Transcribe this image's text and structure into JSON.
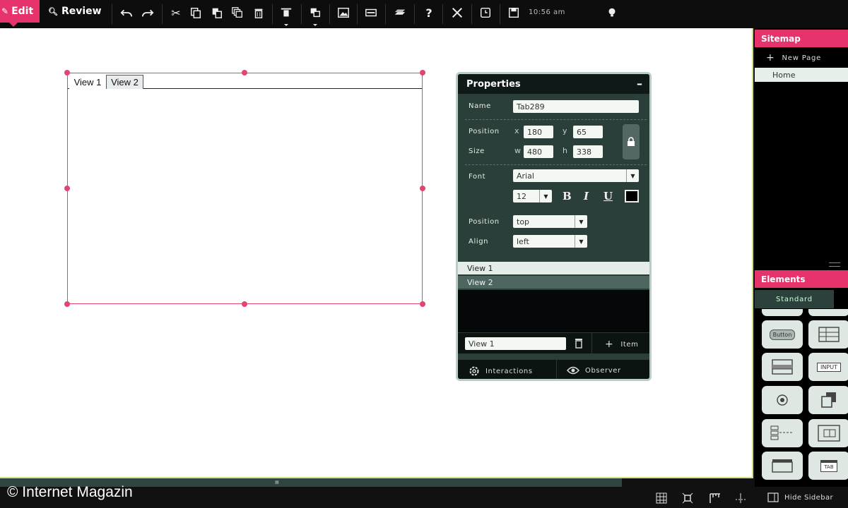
{
  "toolbar": {
    "edit_label": "Edit",
    "review_label": "Review",
    "time": "10:56 am"
  },
  "canvas": {
    "tabs": [
      {
        "label": "View 1",
        "active": true
      },
      {
        "label": "View 2",
        "active": false
      }
    ]
  },
  "watermark": "© Internet Magazin",
  "properties": {
    "title": "Properties",
    "minimize": "–",
    "name_label": "Name",
    "name_value": "Tab289",
    "position_label": "Position",
    "x_label": "x",
    "x_value": "180",
    "y_label": "y",
    "y_value": "65",
    "size_label": "Size",
    "w_label": "w",
    "w_value": "480",
    "h_label": "h",
    "h_value": "338",
    "font_label": "Font",
    "font_value": "Arial",
    "font_size": "12",
    "bold": "B",
    "italic": "I",
    "underline": "U",
    "text_color": "#000000",
    "tab_position_label": "Position",
    "tab_position_value": "top",
    "align_label": "Align",
    "align_value": "left",
    "views": [
      {
        "label": "View 1",
        "selected": true
      },
      {
        "label": "View 2",
        "selected": false
      }
    ],
    "view_name_value": "View 1",
    "add_item_label": "Item",
    "interactions_label": "Interactions",
    "observer_label": "Observer"
  },
  "sidebar": {
    "sitemap_title": "Sitemap",
    "new_page_label": "New Page",
    "pages": [
      "Home"
    ],
    "elements_title": "Elements",
    "elements_tab": "Standard",
    "button_tile_label": "Button",
    "input_tile_label": "INPUT",
    "tab_tile_label": "TAB",
    "hide_label": "Hide Sidebar"
  },
  "colors": {
    "accent": "#e6336b",
    "panel": "#2a3f3a",
    "selection": "#e0466f",
    "canvas_border": "#c9e28a"
  }
}
